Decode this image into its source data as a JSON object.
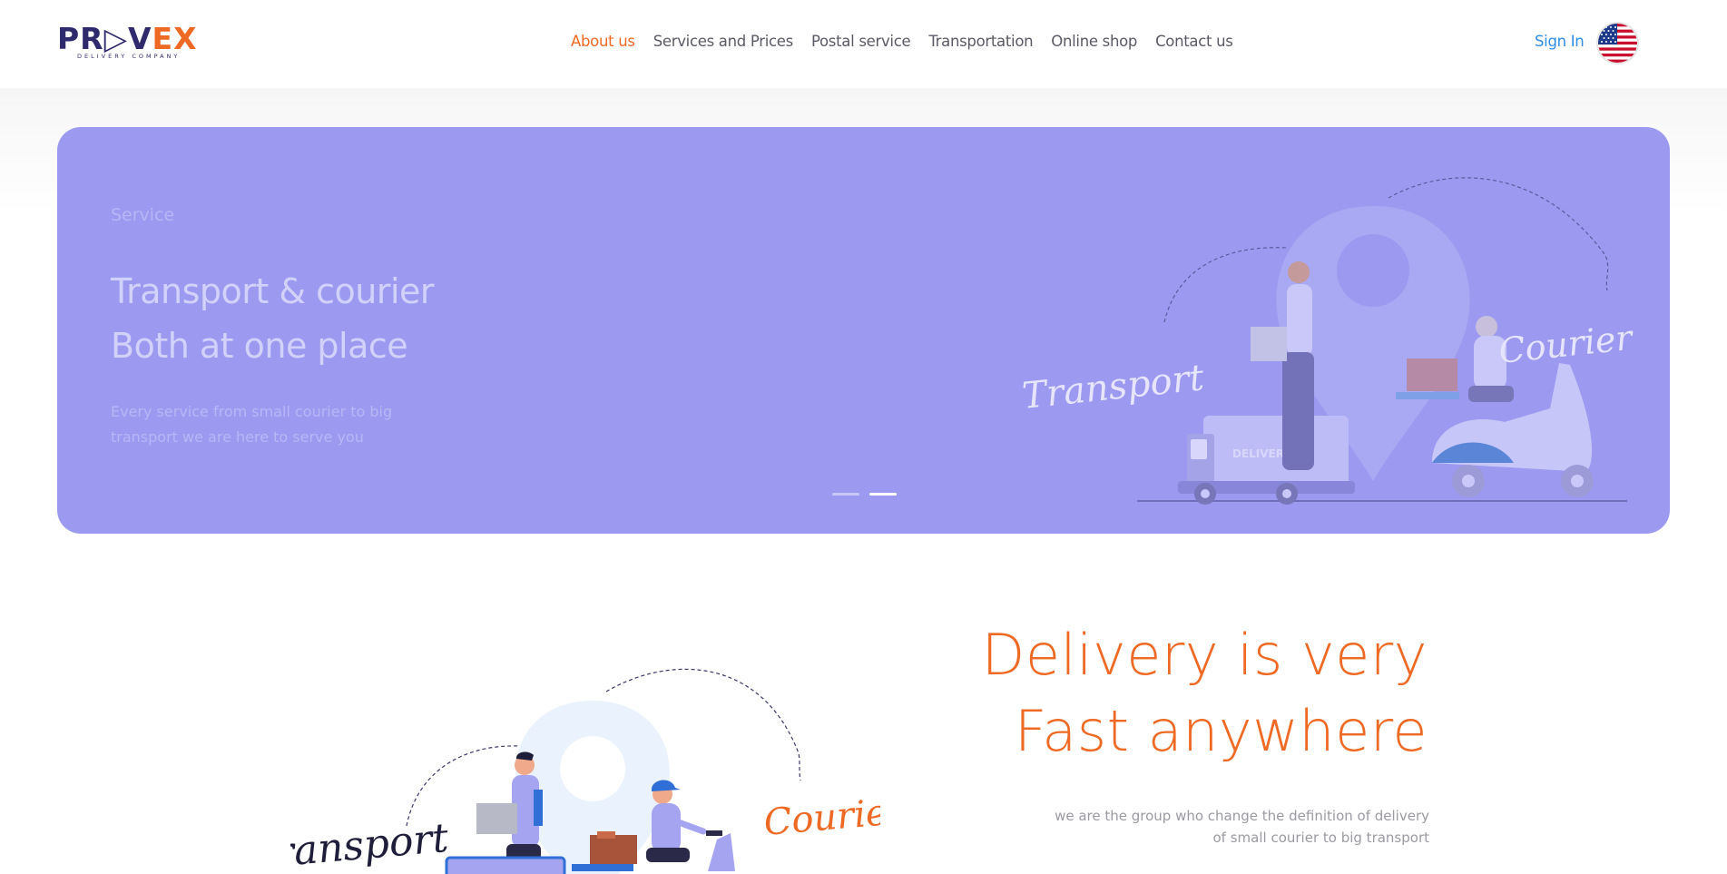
{
  "header": {
    "logo": {
      "brand": "PROVEX",
      "tagline": "DELIVERY COMPANY"
    },
    "nav": [
      {
        "label": "About us",
        "active": true
      },
      {
        "label": "Services and Prices",
        "active": false
      },
      {
        "label": "Postal service",
        "active": false
      },
      {
        "label": "Transportation",
        "active": false
      },
      {
        "label": "Online shop",
        "active": false
      },
      {
        "label": "Contact us",
        "active": false
      }
    ],
    "signin_label": "Sign In",
    "language_icon": "us-flag-icon"
  },
  "hero": {
    "kicker": "Service",
    "title_line1": "Transport & courier",
    "title_line2": "Both at one place",
    "description": "Every service from small courier to big transport we are here to serve you",
    "illustration": {
      "left_word": "Transport",
      "right_word": "Courier",
      "van_text": "DELIVERY"
    },
    "slides": {
      "count": 2,
      "active_index": 1
    },
    "background_color": "#9b9af0"
  },
  "intro": {
    "headline_line1": "Delivery is very",
    "headline_line2": "Fast anywhere",
    "subtext": "we are the group who change the definition of delivery of small courier to big transport",
    "illustration": {
      "left_word": "Transport",
      "right_word": "Courier"
    }
  },
  "colors": {
    "accent": "#ee6a24",
    "brand_dark": "#2e2a6b",
    "link": "#2f8de4"
  }
}
